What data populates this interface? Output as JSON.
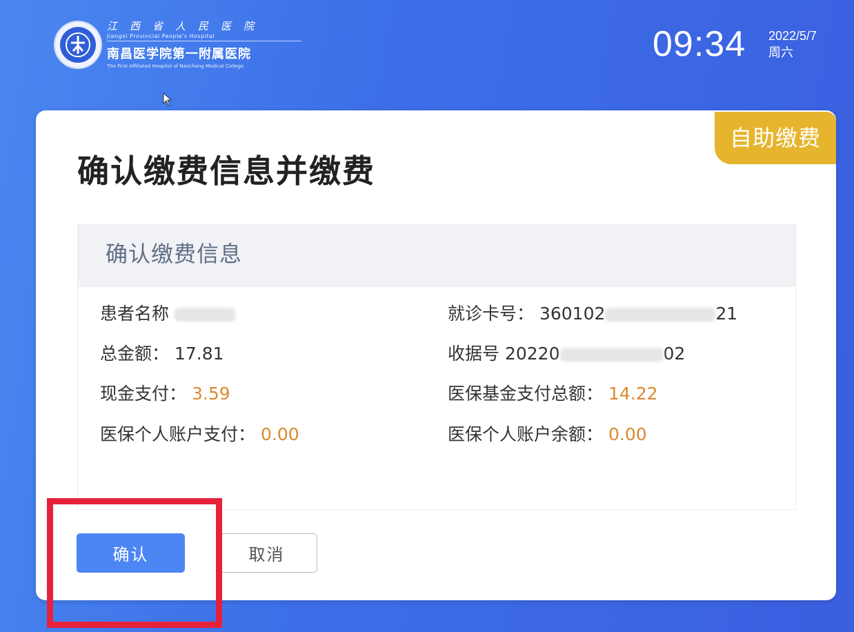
{
  "header": {
    "hospital_name_line1": "江西省人民医院",
    "hospital_name_line1_en": "Jiangxi Provincial People's Hospital",
    "hospital_name_line2": "南昌医学院第一附属医院",
    "hospital_name_line2_en": "The First Affiliated Hospital of Nanchang Medical College",
    "time": "09:34",
    "date": "2022/5/7",
    "weekday": "周六"
  },
  "badge": "自助缴费",
  "page_title": "确认缴费信息并缴费",
  "panel": {
    "title": "确认缴费信息",
    "fields": {
      "patient_name_label": "患者名称",
      "card_no_label": "就诊卡号：",
      "card_no_prefix": "360102",
      "card_no_suffix": "21",
      "total_label": "总金额：",
      "total_value": "17.81",
      "receipt_label": "收据号",
      "receipt_prefix": "20220",
      "receipt_suffix": "02",
      "cash_label": "现金支付：",
      "cash_value": "3.59",
      "fund_label": "医保基金支付总额：",
      "fund_value": "14.22",
      "personal_pay_label": "医保个人账户支付：",
      "personal_pay_value": "0.00",
      "personal_balance_label": "医保个人账户余额：",
      "personal_balance_value": "0.00"
    }
  },
  "buttons": {
    "confirm": "确认",
    "cancel": "取消"
  },
  "colors": {
    "background": "#3d6fe8",
    "badge": "#e6b52d",
    "primary_button": "#4b86f3",
    "amount_highlight": "#d98a2e",
    "annotation_box": "#e8213b"
  }
}
